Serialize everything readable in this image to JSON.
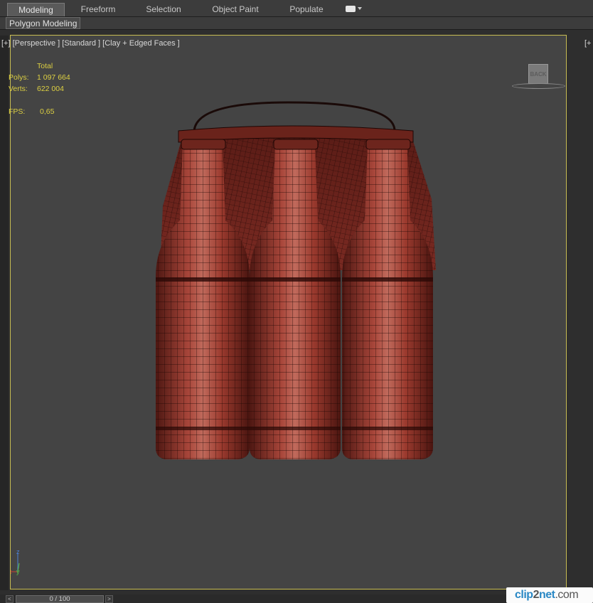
{
  "ribbon": {
    "tabs": [
      {
        "label": "Modeling",
        "active": true
      },
      {
        "label": "Freeform",
        "active": false
      },
      {
        "label": "Selection",
        "active": false
      },
      {
        "label": "Object Paint",
        "active": false
      },
      {
        "label": "Populate",
        "active": false
      }
    ],
    "extra_icon": "chat-bubble-icon"
  },
  "subribbon": {
    "panel_label": "Polygon Modeling"
  },
  "viewport": {
    "label": "[+] [Perspective ] [Standard ] [Clay + Edged Faces ]",
    "stats": {
      "header": "Total",
      "polys_label": "Polys:",
      "polys_value": "1 097 664",
      "verts_label": "Verts:",
      "verts_value": "622 004",
      "fps_label": "FPS:",
      "fps_value": "0,65"
    },
    "viewcube_face": "BACK",
    "axis_labels": {
      "z": "z",
      "x": "x",
      "y": "y"
    },
    "model_color": "#9e3b2f",
    "border_color": "#c8bd52"
  },
  "right_viewport": {
    "label": "[+"
  },
  "timeslider": {
    "value": "0 / 100",
    "prev": "<",
    "next": ">"
  },
  "watermark": {
    "text_a": "clip",
    "text_b": "2",
    "text_c": "net",
    "text_d": ".com"
  }
}
